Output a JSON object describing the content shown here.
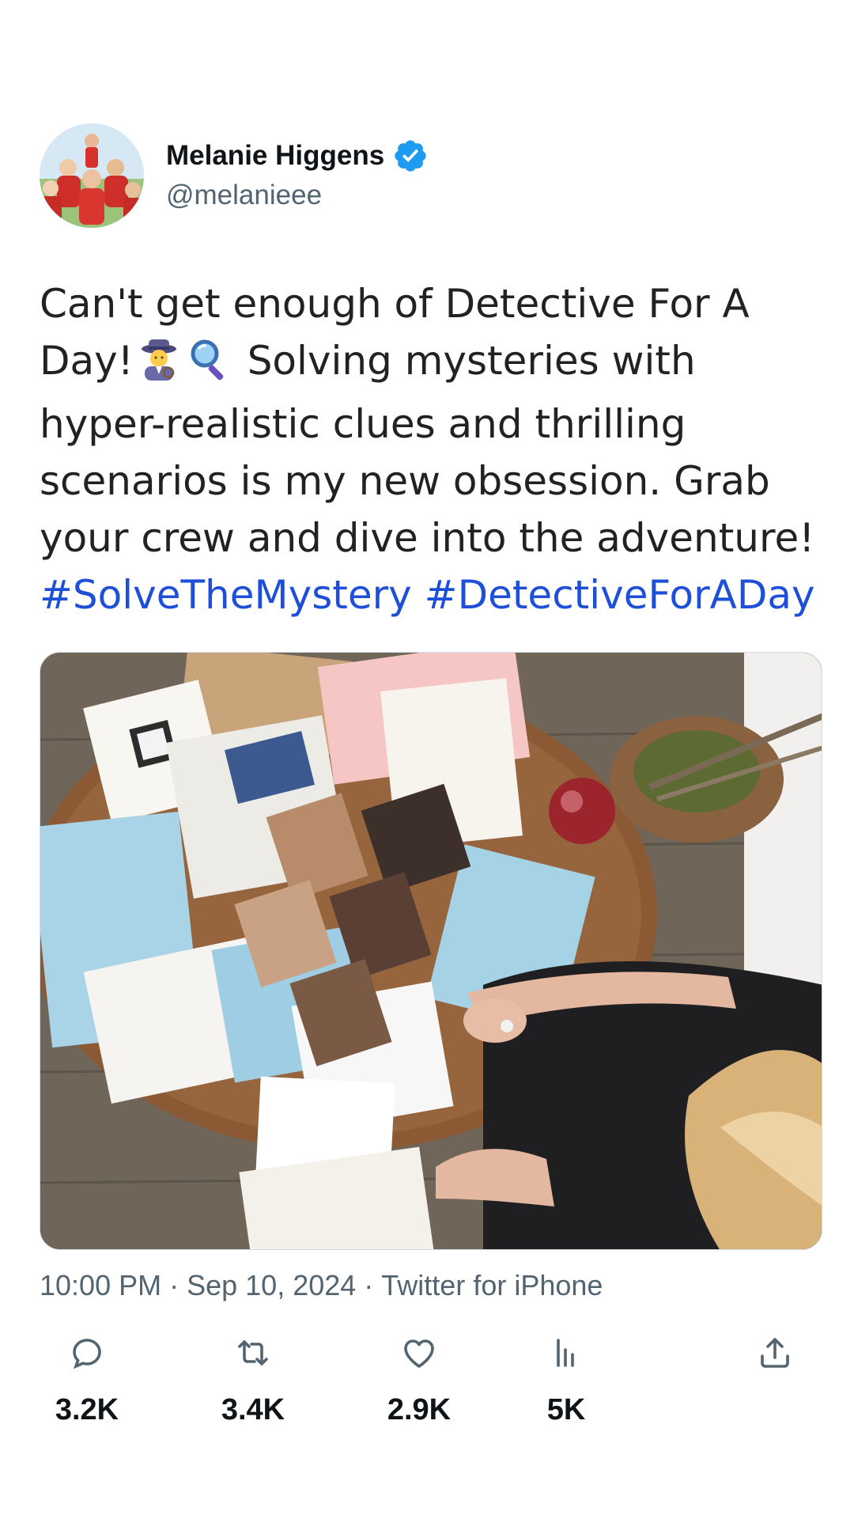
{
  "author": {
    "display_name": "Melanie Higgens",
    "handle": "@melanieee",
    "verified": true
  },
  "tweet": {
    "text_part1": "Can't get enough of Detective For A Day!",
    "emoji_1": "detective-emoji",
    "emoji_2": "magnifying-glass-emoji",
    "text_part2": "Solving mysteries with hyper-realistic clues and thrilling scenarios is my new obsession. Grab your crew and dive into the adventure!",
    "hashtags": [
      "#SolveTheMystery",
      "#DetectiveForADay"
    ]
  },
  "meta": {
    "time": "10:00 PM",
    "date": "Sep 10, 2024",
    "source": "Twitter for iPhone",
    "separator": "·"
  },
  "actions": [
    {
      "name": "reply",
      "icon": "reply-icon",
      "count": "3.2K"
    },
    {
      "name": "retweet",
      "icon": "retweet-icon",
      "count": "3.4K"
    },
    {
      "name": "like",
      "icon": "heart-icon",
      "count": "2.9K"
    },
    {
      "name": "views",
      "icon": "views-icon",
      "count": "5K"
    },
    {
      "name": "share",
      "icon": "share-icon",
      "count": ""
    }
  ],
  "colors": {
    "hashtag": "#1d4fd8",
    "verified": "#1d9bf0",
    "secondary_text": "#536471"
  }
}
